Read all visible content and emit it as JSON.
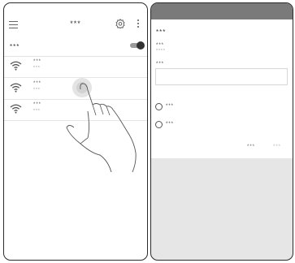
{
  "left_screen": {
    "title": "***",
    "toggle_label": "***",
    "toggle_on": true,
    "networks": [
      {
        "name": "***",
        "sub": "***"
      },
      {
        "name": "***",
        "sub": "***"
      },
      {
        "name": "***",
        "sub": "***"
      }
    ]
  },
  "right_screen": {
    "dialog": {
      "title": "***",
      "field1": {
        "label": "***",
        "value": "****"
      },
      "field2": {
        "label": "***",
        "placeholder": ""
      },
      "options": [
        {
          "label": "***"
        },
        {
          "label": "***"
        }
      ],
      "buttons": {
        "primary": "***",
        "secondary": "***"
      }
    }
  },
  "icons": [
    "menu-icon",
    "gear-icon",
    "more-vert-icon",
    "wifi-icon",
    "hand-pointer-icon",
    "radio-icon"
  ]
}
